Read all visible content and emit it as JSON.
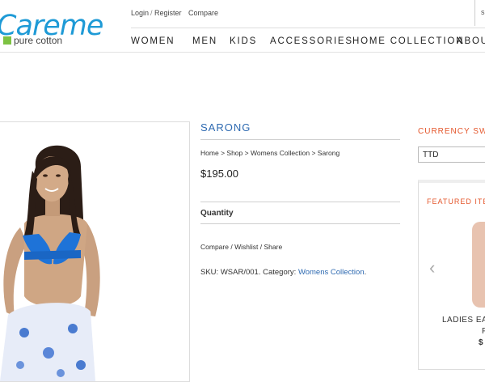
{
  "brand": {
    "name": "Careme",
    "tagline": "pure cotton"
  },
  "top_links": {
    "login": "Login",
    "sep": "/",
    "register": "Register",
    "compare": "Compare"
  },
  "search": {
    "fragment": "s"
  },
  "nav": {
    "items": [
      "WOMEN",
      "MEN",
      "KIDS",
      "ACCESSORIES",
      "HOME COLLECTION",
      "ABOUT"
    ],
    "dropdown_icon": "chevron-down-icon"
  },
  "product": {
    "title": "SARONG",
    "breadcrumb": [
      "Home",
      "Shop",
      "Womens Collection",
      "Sarong"
    ],
    "breadcrumb_sep": ">",
    "price": "$195.00",
    "quantity_label": "Quantity",
    "actions": [
      "Compare",
      "Wishlist",
      "Share"
    ],
    "actions_sep": "/",
    "sku_label": "SKU:",
    "sku": "WSAR/001.",
    "category_label": "Category:",
    "category": "Womens Collection",
    "category_end": "."
  },
  "sidebar": {
    "currency_title": "CURRENCY SWITC",
    "currency_value": "TTD",
    "featured_title": "FEATURED ITEM",
    "featured_prev_icon": "chevron-left-icon",
    "featured_name": "LADIES EAS",
    "featured_name_2": "F",
    "featured_price": "$"
  },
  "colors": {
    "accent_blue": "#2e6ab1",
    "accent_orange": "#e4562b",
    "logo_blue": "#1e9ad6",
    "logo_green": "#7dc242"
  }
}
